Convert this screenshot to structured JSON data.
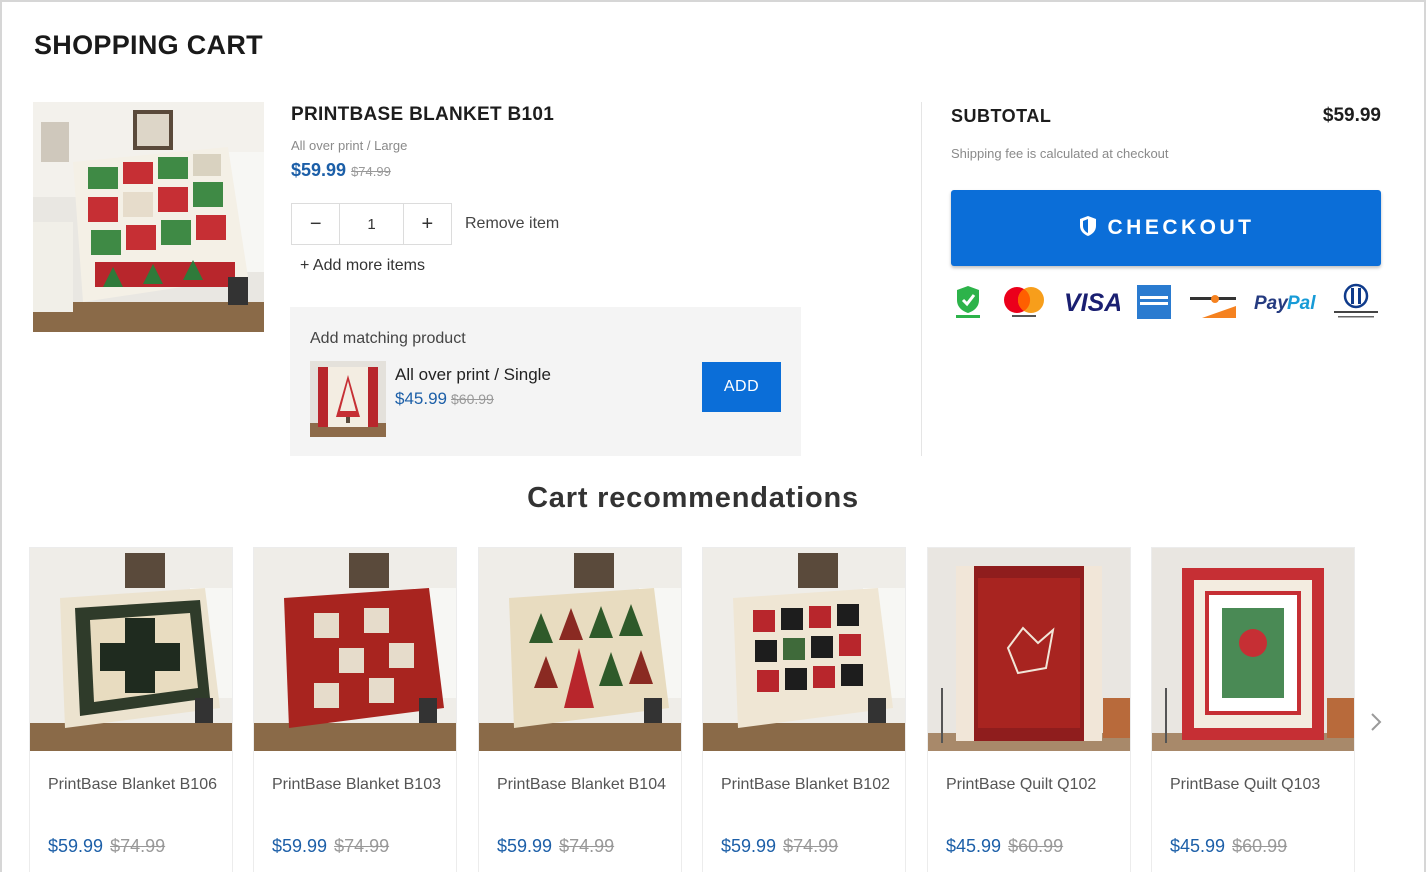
{
  "page": {
    "title": "SHOPPING CART"
  },
  "cart_item": {
    "name": "PRINTBASE BLANKET B101",
    "variant": "All over print / Large",
    "price": "$59.99",
    "compare_price": "$74.99",
    "quantity": "1",
    "minus_label": "−",
    "plus_label": "+",
    "remove_label": "Remove item",
    "add_more_label": "+ Add more items"
  },
  "matching": {
    "heading": "Add matching product",
    "variant": "All over print / Single",
    "price": "$45.99",
    "compare_price": "$60.99",
    "add_label": "ADD"
  },
  "summary": {
    "subtotal_label": "SUBTOTAL",
    "subtotal_value": "$59.99",
    "shipping_note": "Shipping fee is calculated at checkout",
    "checkout_label": "CHECKOUT",
    "payment_methods": [
      "secure-badge",
      "mastercard",
      "visa",
      "american-express",
      "discover",
      "paypal",
      "diners-club"
    ]
  },
  "recommendations": {
    "title": "Cart recommendations",
    "items": [
      {
        "name": "PrintBase Blanket B106",
        "price": "$59.99",
        "compare_price": "$74.99"
      },
      {
        "name": "PrintBase Blanket B103",
        "price": "$59.99",
        "compare_price": "$74.99"
      },
      {
        "name": "PrintBase Blanket B104",
        "price": "$59.99",
        "compare_price": "$74.99"
      },
      {
        "name": "PrintBase Blanket B102",
        "price": "$59.99",
        "compare_price": "$74.99"
      },
      {
        "name": "PrintBase Quilt Q102",
        "price": "$45.99",
        "compare_price": "$60.99"
      },
      {
        "name": "PrintBase Quilt Q103",
        "price": "$45.99",
        "compare_price": "$60.99"
      }
    ],
    "next_icon": "chevron-right-icon"
  },
  "colors": {
    "accent_blue": "#0b6ed8",
    "price_blue": "#1c5fa8"
  }
}
